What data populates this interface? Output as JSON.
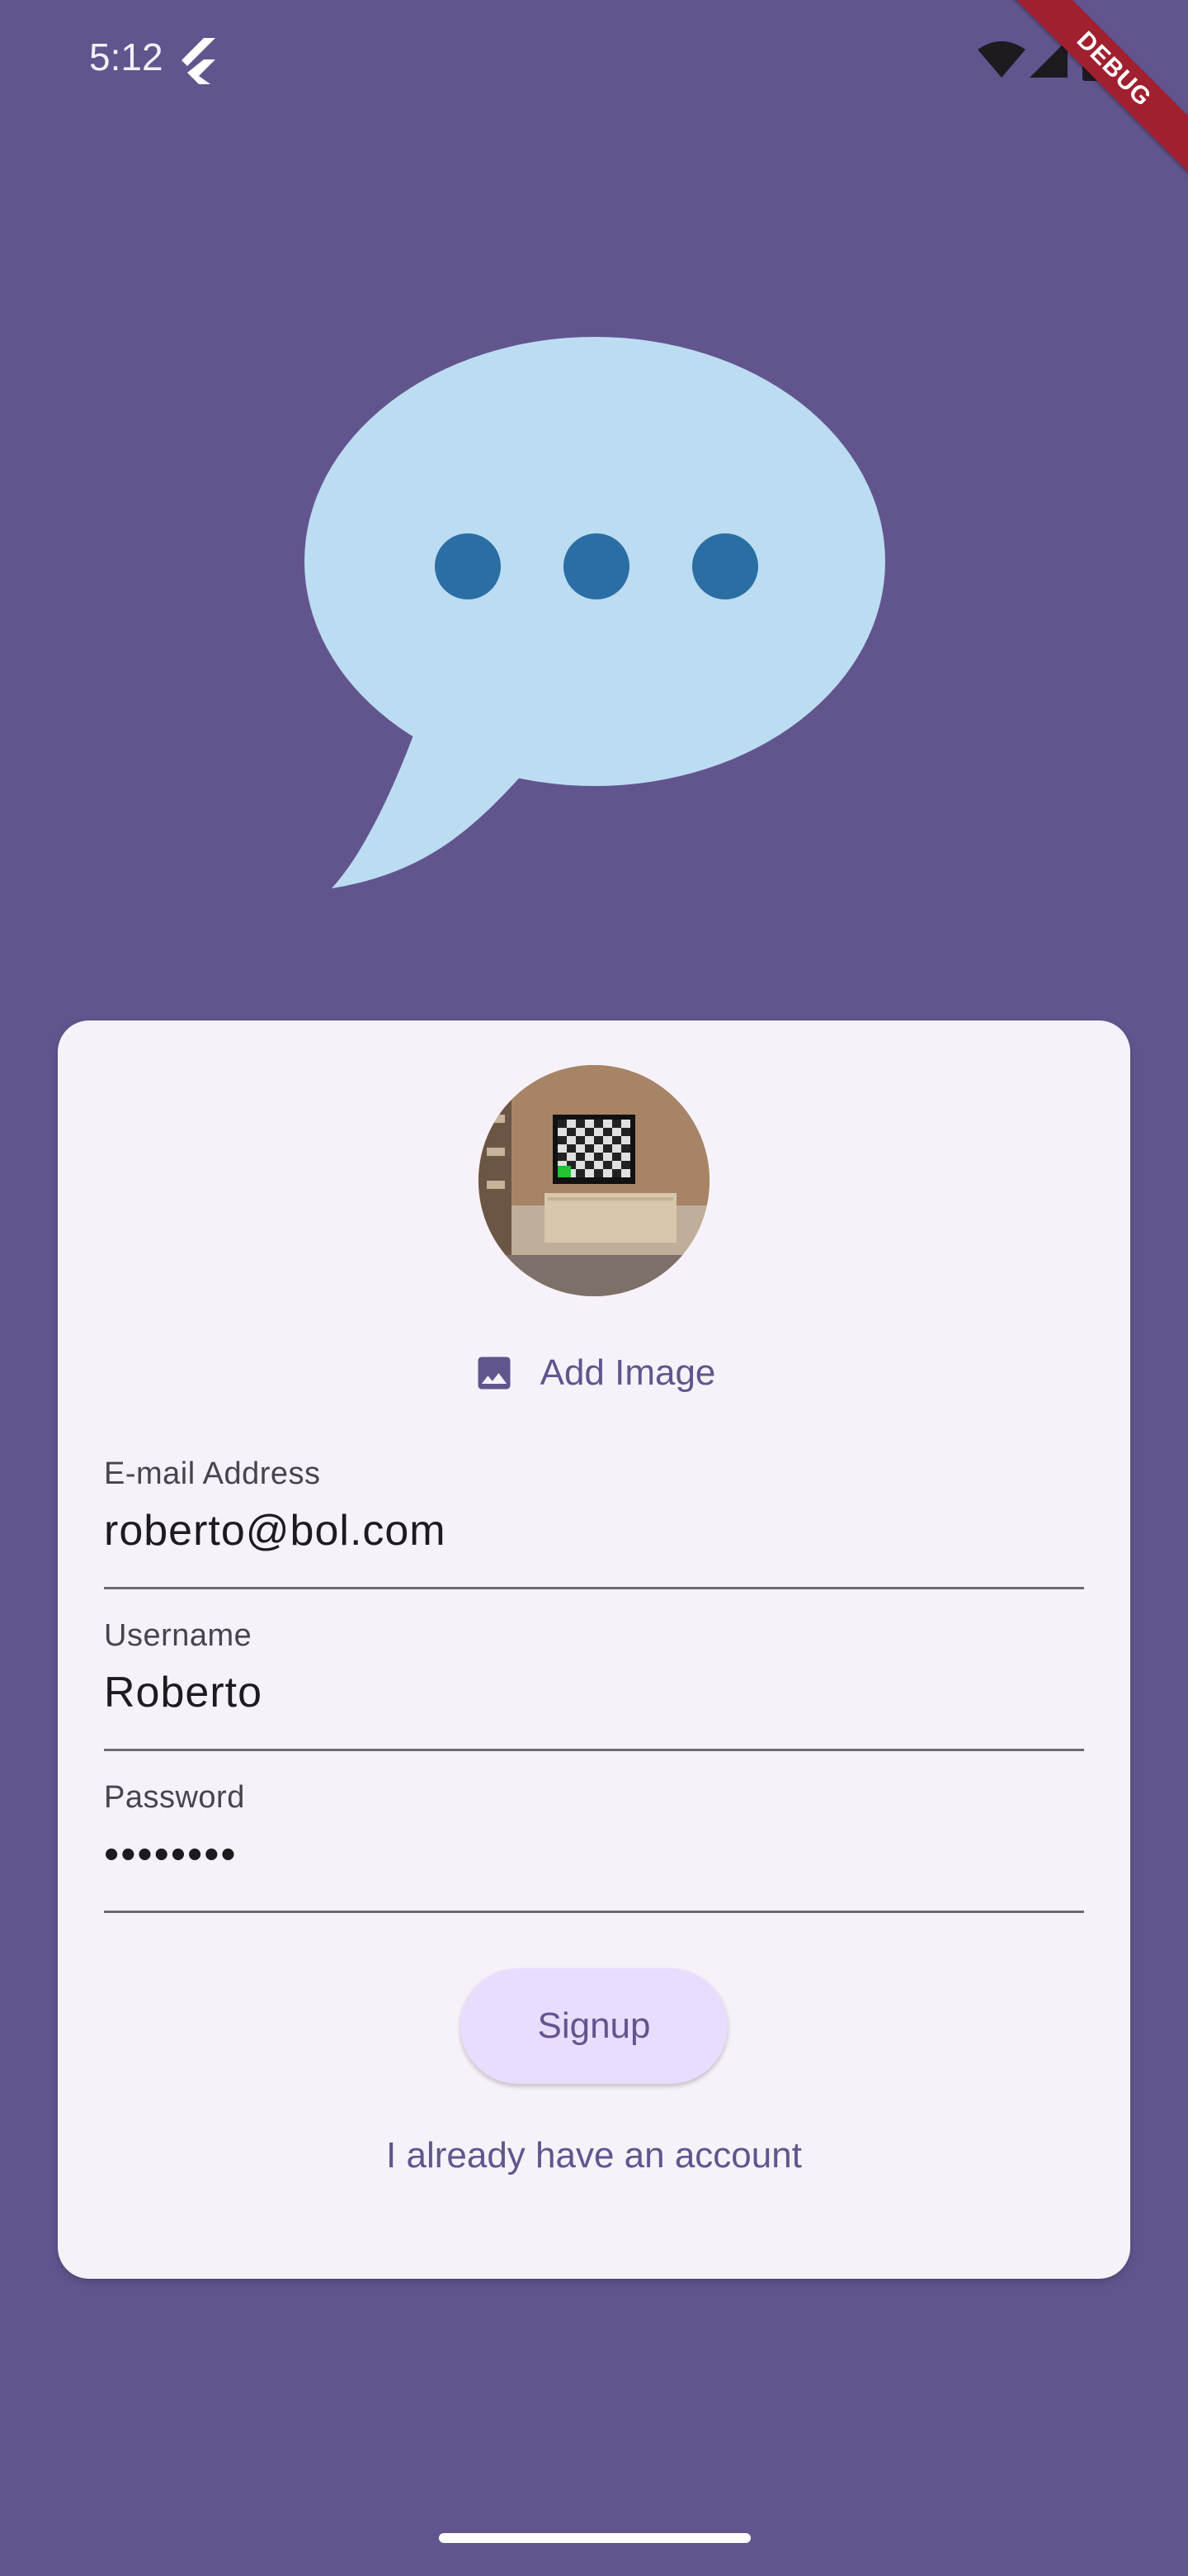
{
  "status_bar": {
    "time": "5:12",
    "debug_label": "DEBUG",
    "icons": [
      "flutter-icon",
      "wifi-icon",
      "signal-icon",
      "battery-icon"
    ]
  },
  "logo": {
    "icon": "chat-bubble-icon",
    "colors": {
      "bubble": "#bcdcf2",
      "dots": "#2b6ea3"
    }
  },
  "card": {
    "avatar": {
      "icon": "avatar-image"
    },
    "add_image": {
      "label": "Add Image",
      "icon": "image-icon"
    },
    "fields": {
      "email": {
        "label": "E-mail Address",
        "value": "roberto@bol.com"
      },
      "username": {
        "label": "Username",
        "value": "Roberto"
      },
      "password": {
        "label": "Password",
        "value": "••••••••"
      }
    },
    "signup_label": "Signup",
    "login_link": "I already have an account"
  },
  "colors": {
    "background": "#62558e",
    "card": "#f7f2f9",
    "primary": "#62558e",
    "button": "#e9ddff"
  }
}
